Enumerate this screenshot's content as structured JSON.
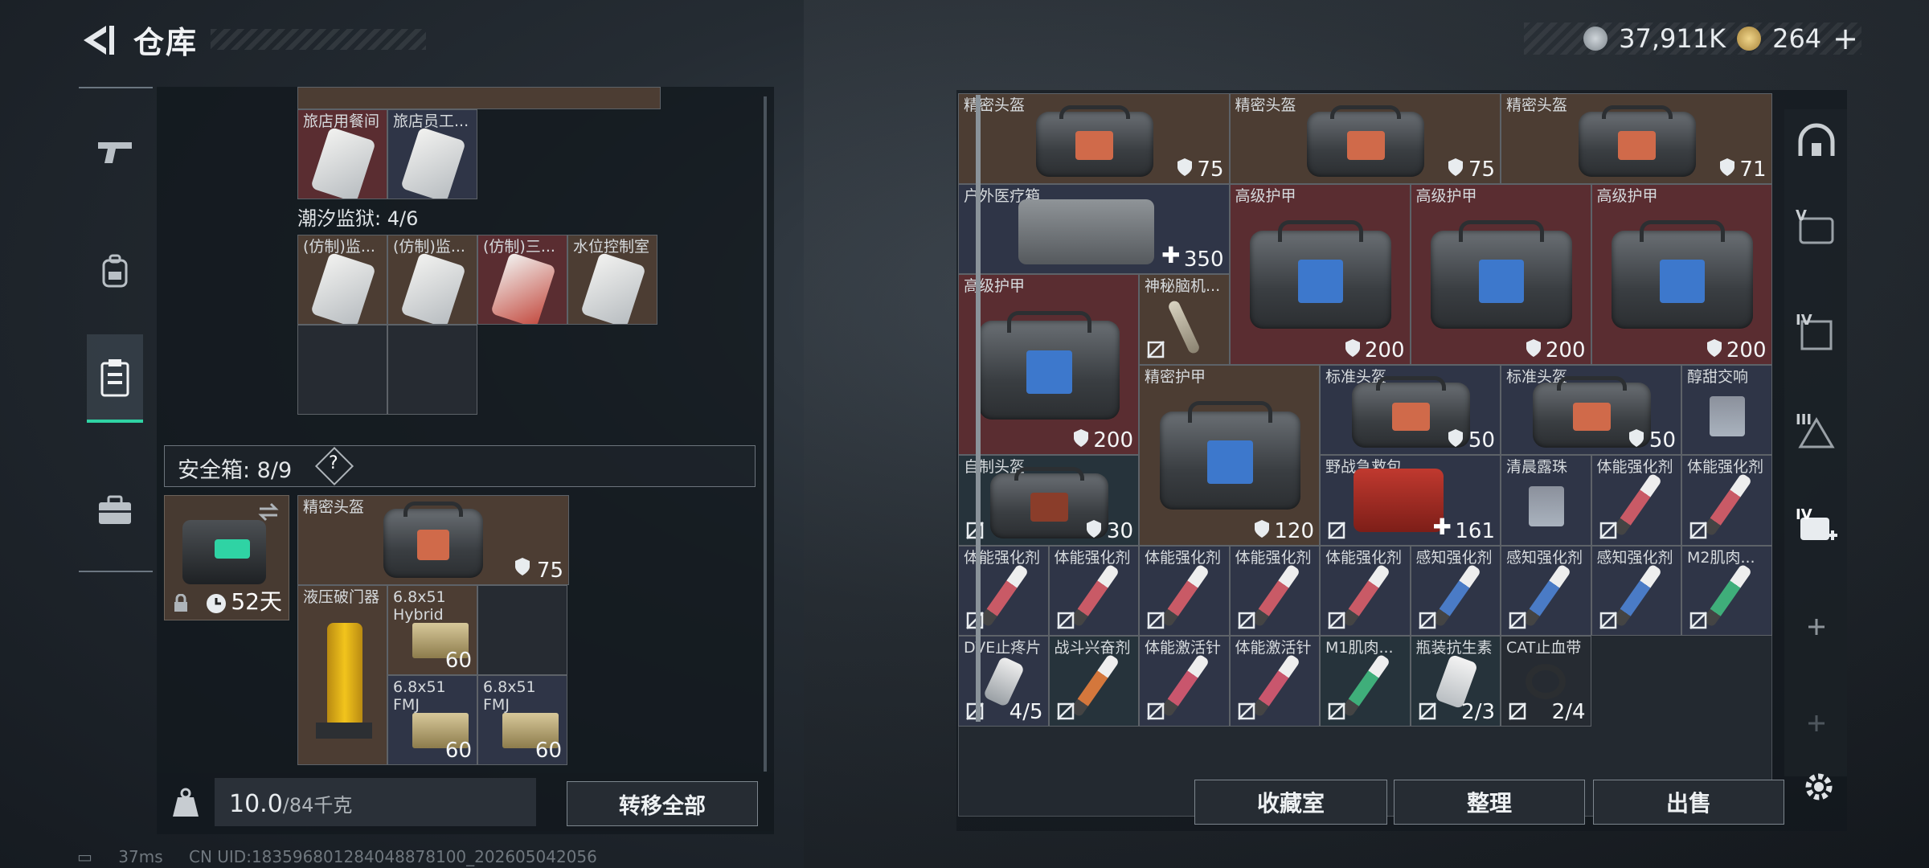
{
  "header": {
    "title": "仓库"
  },
  "currency": {
    "coin1": "37,911K",
    "coin2": "264",
    "plus": "+"
  },
  "left": {
    "top_row": {
      "items": [
        {
          "label": "旅店用餐间",
          "color": "red"
        },
        {
          "label": "旅店员工...",
          "color": "blue"
        }
      ]
    },
    "prison": {
      "title": "潮汐监狱: 4/6",
      "items": [
        {
          "label": "(仿制)监...",
          "color": "brown"
        },
        {
          "label": "(仿制)监...",
          "color": "brown"
        },
        {
          "label": "(仿制)三...",
          "color": "red"
        },
        {
          "label": "水位控制室",
          "color": "brown"
        }
      ]
    },
    "safe": {
      "title": "安全箱: 8/9",
      "help": "?",
      "days": "52天"
    },
    "safe_items": [
      {
        "label": "精密头盔",
        "value": "75",
        "kind": "helmet"
      },
      {
        "label": "液压破门器",
        "value": "",
        "kind": "tool"
      },
      {
        "label": "6.8x51 Hybrid",
        "value": "60",
        "kind": "ammo"
      },
      {
        "label": "6.8x51 FMJ",
        "value": "60",
        "kind": "ammo"
      },
      {
        "label": "6.8x51 FMJ",
        "value": "60",
        "kind": "ammo"
      }
    ],
    "weight": {
      "current": "10.0",
      "max": "/84千克"
    },
    "transfer_label": "转移全部"
  },
  "right": {
    "items": [
      {
        "label": "精密头盔",
        "value": "75"
      },
      {
        "label": "精密头盔",
        "value": "75"
      },
      {
        "label": "精密头盔",
        "value": "71"
      },
      {
        "label": "户外医疗箱",
        "value": "350"
      },
      {
        "label": "高级护甲",
        "value": "200"
      },
      {
        "label": "高级护甲",
        "value": "200"
      },
      {
        "label": "高级护甲",
        "value": "200"
      },
      {
        "label": "高级护甲",
        "value": "200"
      },
      {
        "label": "神秘脑机...",
        "value": ""
      },
      {
        "label": "精密护甲",
        "value": "120"
      },
      {
        "label": "标准头盔",
        "value": "50"
      },
      {
        "label": "标准头盔",
        "value": "50"
      },
      {
        "label": "醇甜交响",
        "value": ""
      },
      {
        "label": "自制头盔",
        "value": "30"
      },
      {
        "label": "野战急救包",
        "value": "161"
      },
      {
        "label": "清晨露珠",
        "value": ""
      },
      {
        "label": "体能强化剂",
        "value": ""
      },
      {
        "label": "体能强化剂",
        "value": ""
      },
      {
        "label": "体能强化剂",
        "value": ""
      },
      {
        "label": "体能强化剂",
        "value": ""
      },
      {
        "label": "体能强化剂",
        "value": ""
      },
      {
        "label": "体能强化剂",
        "value": ""
      },
      {
        "label": "体能强化剂",
        "value": ""
      },
      {
        "label": "感知强化剂",
        "value": ""
      },
      {
        "label": "感知强化剂",
        "value": ""
      },
      {
        "label": "感知强化剂",
        "value": ""
      },
      {
        "label": "M2肌肉...",
        "value": ""
      },
      {
        "label": "DVE止疼片",
        "value": "4/5"
      },
      {
        "label": "战斗兴奋剂",
        "value": ""
      },
      {
        "label": "体能激活针",
        "value": ""
      },
      {
        "label": "体能激活针",
        "value": ""
      },
      {
        "label": "M1肌肉...",
        "value": ""
      },
      {
        "label": "瓶装抗生素",
        "value": "2/3"
      },
      {
        "label": "CAT止血带",
        "value": "2/4"
      }
    ],
    "buttons": {
      "collection": "收藏室",
      "organize": "整理",
      "sell": "出售"
    },
    "sidebar_roman": {
      "v": "V",
      "iv": "IV",
      "iii": "III",
      "iv2": "IV"
    }
  },
  "status": {
    "ping": "37ms",
    "uid": "CN UID:1835968012840488781​00_202605042056"
  },
  "colors": {
    "accent": "#2fd3a4"
  }
}
